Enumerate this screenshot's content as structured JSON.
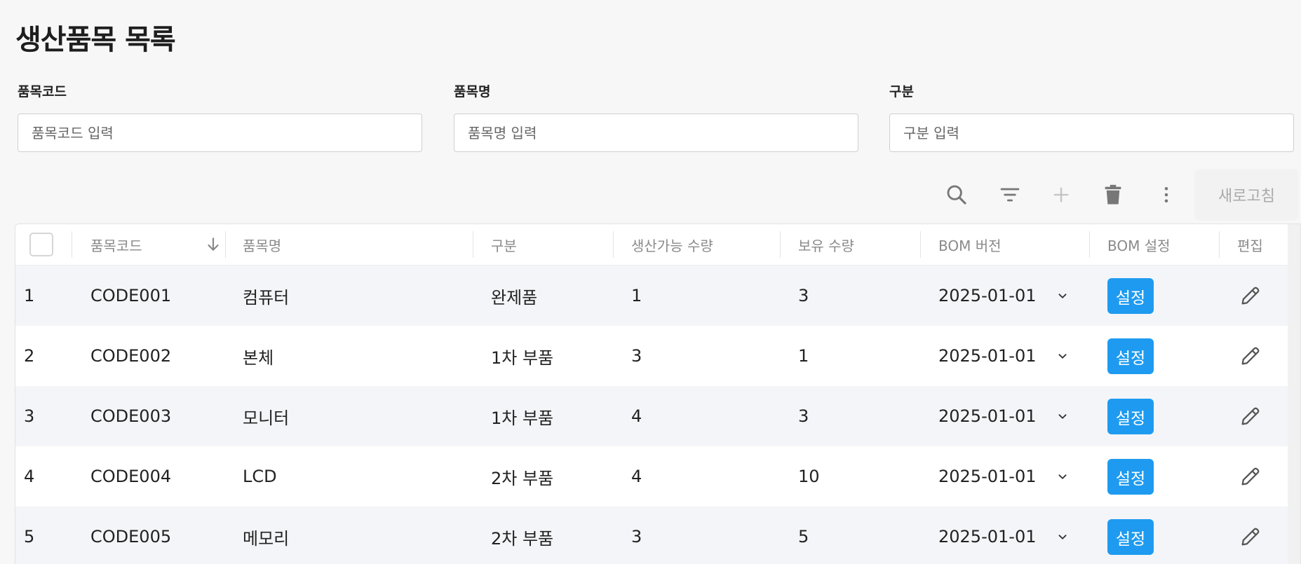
{
  "page": {
    "title": "생산품목 목록"
  },
  "filters": [
    {
      "label": "품목코드",
      "placeholder": "품목코드 입력"
    },
    {
      "label": "품목명",
      "placeholder": "품목명 입력"
    },
    {
      "label": "구분",
      "placeholder": "구분 입력"
    }
  ],
  "toolbar": {
    "icons": [
      "search-icon",
      "filter-icon",
      "add-icon",
      "delete-icon",
      "more-vertical-icon"
    ],
    "refresh_label": "새로고침"
  },
  "table": {
    "columns": [
      "품목코드",
      "품목명",
      "구분",
      "생산가능 수량",
      "보유 수량",
      "BOM 버전",
      "BOM 설정",
      "편집"
    ],
    "sort_icon": "arrow-down-icon",
    "set_label": "설정",
    "rows": [
      {
        "no": "1",
        "code": "CODE001",
        "name": "컴퓨터",
        "type": "완제품",
        "producible": "1",
        "stock": "3",
        "bom_version": "2025-01-01"
      },
      {
        "no": "2",
        "code": "CODE002",
        "name": "본체",
        "type": "1차 부품",
        "producible": "3",
        "stock": "1",
        "bom_version": "2025-01-01"
      },
      {
        "no": "3",
        "code": "CODE003",
        "name": "모니터",
        "type": "1차 부품",
        "producible": "4",
        "stock": "3",
        "bom_version": "2025-01-01"
      },
      {
        "no": "4",
        "code": "CODE004",
        "name": "LCD",
        "type": "2차 부품",
        "producible": "4",
        "stock": "10",
        "bom_version": "2025-01-01"
      },
      {
        "no": "5",
        "code": "CODE005",
        "name": "메모리",
        "type": "2차 부품",
        "producible": "3",
        "stock": "5",
        "bom_version": "2025-01-01"
      }
    ]
  },
  "colors": {
    "accent": "#1e9bf0",
    "row_alt": "#f4f5f8",
    "icon": "#777777"
  }
}
